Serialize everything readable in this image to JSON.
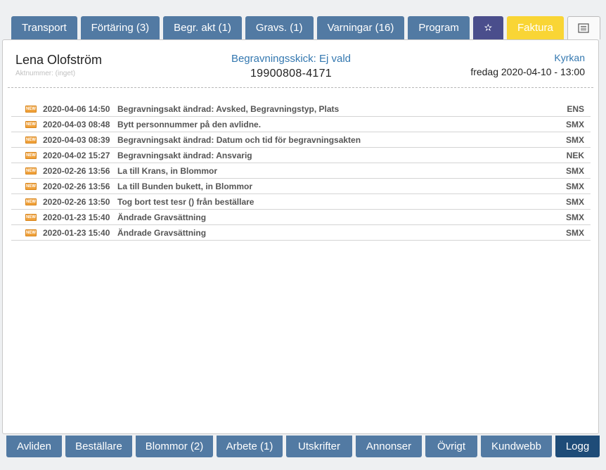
{
  "top_tabs": [
    {
      "label": "Transport"
    },
    {
      "label": "Förtäring (3)"
    },
    {
      "label": "Begr. akt (1)"
    },
    {
      "label": "Gravs. (1)"
    },
    {
      "label": "Varningar (16)"
    },
    {
      "label": "Program"
    },
    {
      "label": "✫",
      "icon": "star-icon"
    },
    {
      "label": "Faktura"
    },
    {
      "label": "",
      "icon": "notes-icon"
    }
  ],
  "header": {
    "name": "Lena Olofström",
    "act_number": "Aktnummer: (inget)",
    "status": "Begravningsskick: Ej vald",
    "personal_number": "19900808-4171",
    "place": "Kyrkan",
    "datetime": "fredag 2020-04-10 - 13:00"
  },
  "log": {
    "badge": "NEW",
    "entries": [
      {
        "timestamp": "2020-04-06 14:50",
        "message": "Begravningsakt ändrad: Avsked, Begravningstyp, Plats",
        "user": "ENS"
      },
      {
        "timestamp": "2020-04-03 08:48",
        "message": "Bytt personnummer på den avlidne.",
        "user": "SMX"
      },
      {
        "timestamp": "2020-04-03 08:39",
        "message": "Begravningsakt ändrad: Datum och tid för begravningsakten",
        "user": "SMX"
      },
      {
        "timestamp": "2020-04-02 15:27",
        "message": "Begravningsakt ändrad: Ansvarig",
        "user": "NEK"
      },
      {
        "timestamp": "2020-02-26 13:56",
        "message": "La till Krans, in Blommor",
        "user": "SMX"
      },
      {
        "timestamp": "2020-02-26 13:56",
        "message": "La till Bunden bukett, in Blommor",
        "user": "SMX"
      },
      {
        "timestamp": "2020-02-26 13:50",
        "message": "Tog bort test tesr () från beställare",
        "user": "SMX"
      },
      {
        "timestamp": "2020-01-23 15:40",
        "message": "Ändrade Gravsättning",
        "user": "SMX"
      },
      {
        "timestamp": "2020-01-23 15:40",
        "message": "Ändrade Gravsättning",
        "user": "SMX"
      }
    ]
  },
  "bottom_tabs": [
    {
      "label": "Avliden"
    },
    {
      "label": "Beställare"
    },
    {
      "label": "Blommor (2)"
    },
    {
      "label": "Arbete (1)"
    },
    {
      "label": "Utskrifter"
    },
    {
      "label": "Annonser"
    },
    {
      "label": "Övrigt"
    },
    {
      "label": "Kundwebb"
    },
    {
      "label": "Logg",
      "active": true
    }
  ],
  "colors": {
    "tab_blue": "#527aa3",
    "tab_active": "#1e4c78",
    "star_tab": "#4a4e8c",
    "invoice_tab": "#f9d535",
    "link_blue": "#3478b0"
  }
}
